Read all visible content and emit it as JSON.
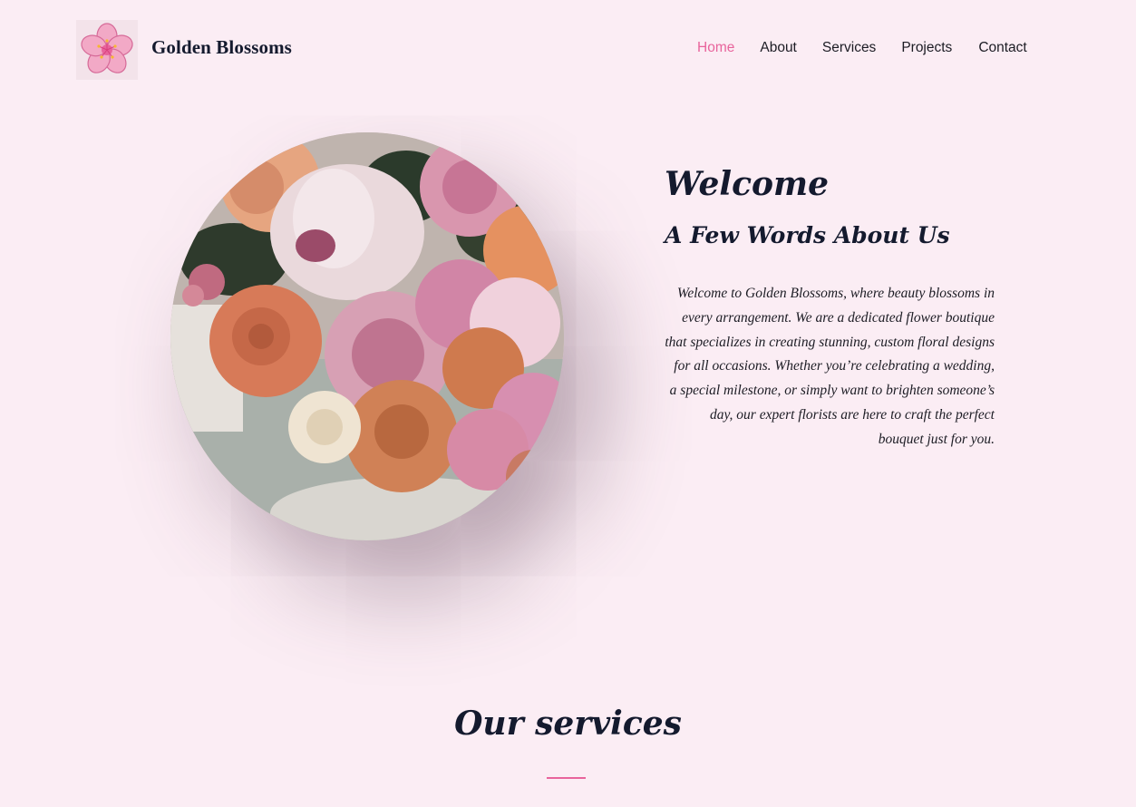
{
  "brand": {
    "name": "Golden Blossoms",
    "logo_icon": "cherry-blossom-icon"
  },
  "nav": {
    "items": [
      {
        "label": "Home",
        "active": true
      },
      {
        "label": "About",
        "active": false
      },
      {
        "label": "Services",
        "active": false
      },
      {
        "label": "Projects",
        "active": false
      },
      {
        "label": "Contact",
        "active": false
      }
    ]
  },
  "hero": {
    "image": "flower-bouquet-image"
  },
  "welcome": {
    "title": "Welcome",
    "subtitle": "A Few Words About Us",
    "body": "Welcome to Golden Blossoms, where beauty blossoms in every arrangement. We are a dedicated flower boutique that specializes in creating stunning, custom floral designs for all occasions. Whether you’re celebrating a wedding, a special milestone, or simply want to brighten someone’s day, our expert florists are here to craft the perfect bouquet just for you."
  },
  "services": {
    "title": "Our services"
  },
  "colors": {
    "background": "#fbedf4",
    "accent": "#e8649c",
    "text": "#141a2e"
  }
}
